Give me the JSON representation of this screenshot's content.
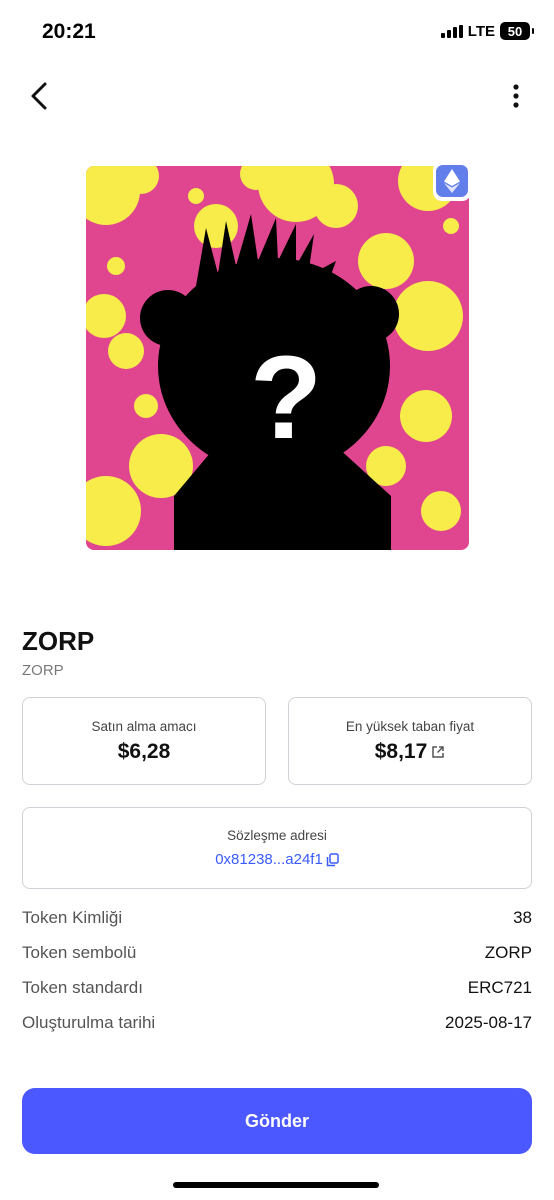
{
  "status": {
    "time": "20:21",
    "network": "LTE",
    "battery": "50"
  },
  "nav": {
    "back_icon": "chevron-left-icon",
    "more_icon": "more-vertical-icon"
  },
  "image": {
    "chain_icon": "ethereum-icon",
    "background_color": "#e0468f",
    "splash_color": "#f7ec4a"
  },
  "token": {
    "name": "ZORP",
    "symbol_sub": "ZORP"
  },
  "cards": {
    "purchase_label": "Satın alma amacı",
    "purchase_value": "$6,28",
    "floor_label": "En yüksek taban fiyat",
    "floor_value": "$8,17",
    "contract_label": "Sözleşme adresi",
    "contract_value": "0x81238...a24f1"
  },
  "details": [
    {
      "label": "Token Kimliği",
      "value": "38"
    },
    {
      "label": "Token sembolü",
      "value": "ZORP"
    },
    {
      "label": "Token standardı",
      "value": "ERC721"
    },
    {
      "label": "Oluşturulma tarihi",
      "value": "2025-08-17"
    }
  ],
  "send_button": {
    "label": "Gönder"
  },
  "colors": {
    "accent": "#4b57ff",
    "link": "#3b5bfd"
  }
}
